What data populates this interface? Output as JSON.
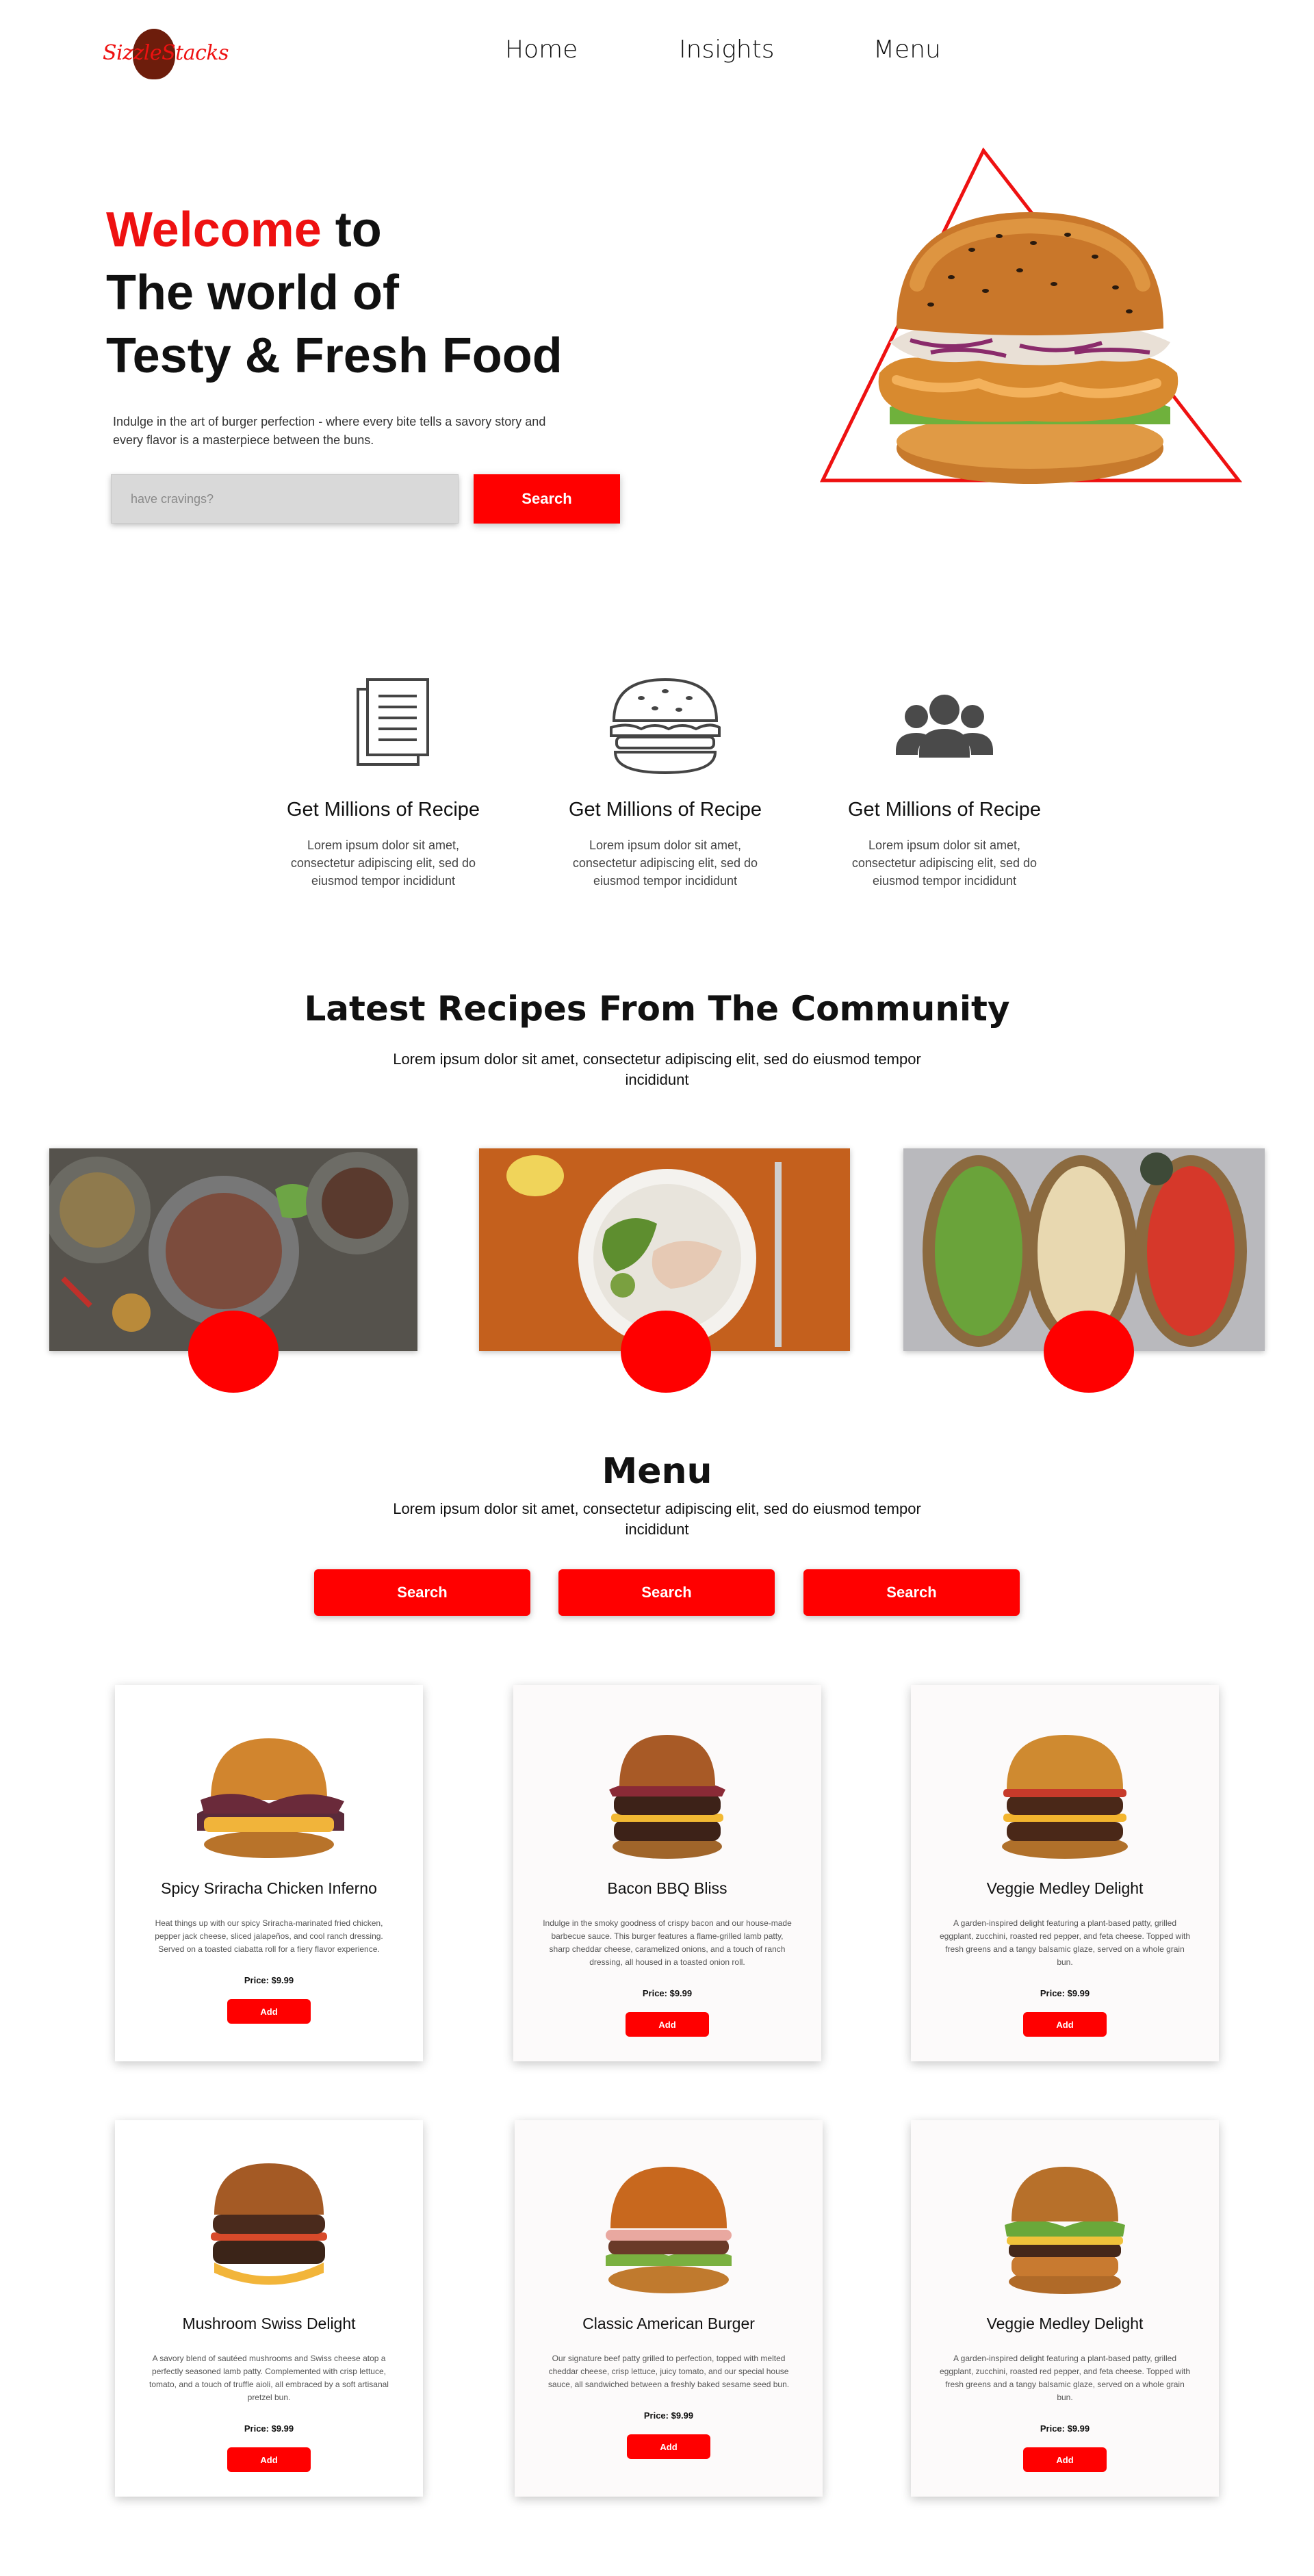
{
  "brand": {
    "logo_text": "SizzleStacks",
    "accent": "#ff0000",
    "logo_bg": "#6d1d0c"
  },
  "nav": {
    "items": [
      "Home",
      "Insights",
      "Menu"
    ]
  },
  "hero": {
    "title_highlight": "Welcome",
    "title_rest_line1": " to",
    "title_line2": "The world of",
    "title_line3": "Testy & Fresh Food",
    "description": "Indulge in the art of burger perfection - where every bite tells a savory story and every flavor is a masterpiece between the buns.",
    "search_placeholder": "have cravings?",
    "search_button": "Search"
  },
  "features": [
    {
      "icon": "document-icon",
      "title": "Get Millions of  Recipe",
      "text": "Lorem ipsum dolor sit amet, consectetur adipiscing elit, sed do eiusmod tempor incididunt"
    },
    {
      "icon": "burger-outline-icon",
      "title": "Get Millions of  Recipe",
      "text": "Lorem ipsum dolor sit amet, consectetur adipiscing elit, sed do eiusmod tempor incididunt"
    },
    {
      "icon": "users-icon",
      "title": "Get Millions of  Recipe",
      "text": "Lorem ipsum dolor sit amet, consectetur adipiscing elit, sed do eiusmod tempor incididunt"
    }
  ],
  "community": {
    "title": "Latest Recipes From The Community",
    "subtitle": "Lorem ipsum dolor sit amet, consectetur adipiscing elit, sed do eiusmod tempor incididunt"
  },
  "menu": {
    "title": "Menu",
    "subtitle": "Lorem ipsum dolor sit amet, consectetur adipiscing elit, sed do eiusmod tempor incididunt",
    "buttons": [
      "Search",
      "Search",
      "Search"
    ],
    "items": [
      {
        "name": "Spicy Sriracha Chicken Inferno",
        "description": "Heat things up with our spicy Sriracha-marinated fried chicken, pepper jack cheese, sliced jalapeños, and cool ranch dressing. Served on a toasted ciabatta roll for a fiery flavor experience.",
        "price": "Price: $9.99",
        "button": "Add"
      },
      {
        "name": "Bacon BBQ Bliss",
        "description": "Indulge in the smoky goodness of crispy bacon and our house-made barbecue sauce. This burger features a flame-grilled lamb patty, sharp cheddar cheese, caramelized onions, and a touch of ranch dressing, all housed in a toasted onion roll.",
        "price": "Price: $9.99",
        "button": "Add"
      },
      {
        "name": "Veggie Medley Delight",
        "description": "A garden-inspired delight featuring a plant-based patty, grilled eggplant, zucchini, roasted red pepper, and feta cheese. Topped with fresh greens and a tangy balsamic glaze, served on a whole grain bun.",
        "price": "Price: $9.99",
        "button": "Add"
      },
      {
        "name": "Mushroom Swiss Delight",
        "description": "A savory blend of sautéed mushrooms and Swiss cheese atop a perfectly seasoned lamb patty. Complemented with crisp lettuce, tomato, and a touch of truffle aioli, all embraced by a soft artisanal pretzel bun.",
        "price": "Price: $9.99",
        "button": "Add"
      },
      {
        "name": "Classic American Burger",
        "description": "Our signature beef patty grilled to perfection, topped with melted cheddar cheese, crisp lettuce, juicy tomato, and our special house sauce, all sandwiched between a freshly baked sesame seed bun.",
        "price": "Price: $9.99",
        "button": "Add"
      },
      {
        "name": "Veggie Medley Delight",
        "description": "A garden-inspired delight featuring a plant-based patty, grilled eggplant, zucchini, roasted red pepper, and feta cheese. Topped with fresh greens and a tangy balsamic glaze, served on a whole grain bun.",
        "price": "Price: $9.99",
        "button": "Add"
      }
    ]
  }
}
